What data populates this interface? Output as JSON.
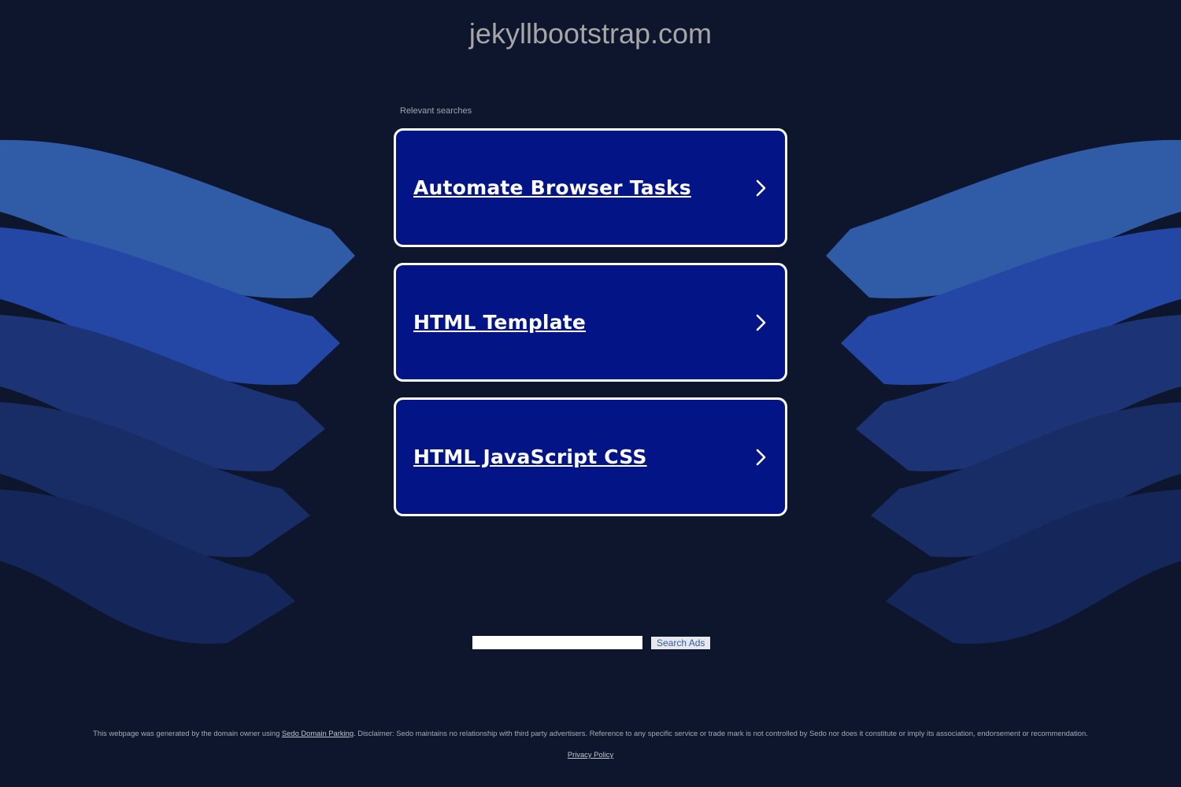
{
  "header": {
    "domain": "jekyllbootstrap.com"
  },
  "results": {
    "label": "Relevant searches",
    "items": [
      {
        "label": "Automate Browser Tasks"
      },
      {
        "label": "HTML Template"
      },
      {
        "label": "HTML JavaScript CSS"
      }
    ]
  },
  "search": {
    "value": "",
    "button_label": "Search Ads"
  },
  "footer": {
    "disclaimer_prefix": "This webpage was generated by the domain owner using ",
    "disclaimer_link": "Sedo Domain Parking",
    "disclaimer_suffix": ". Disclaimer: Sedo maintains no relationship with third party advertisers. Reference to any specific service or trade mark is not controlled by Sedo nor does it constitute or imply its association, endorsement or recommendation.",
    "privacy_label": "Privacy Policy"
  },
  "colors": {
    "background": "#0e162e",
    "card": "#031586",
    "wave_1": "#2f5ba7",
    "wave_2": "#2447a5",
    "wave_3": "#1c3476",
    "wave_4": "#182c66",
    "wave_5": "#15265a",
    "wave_6": "#142357"
  }
}
